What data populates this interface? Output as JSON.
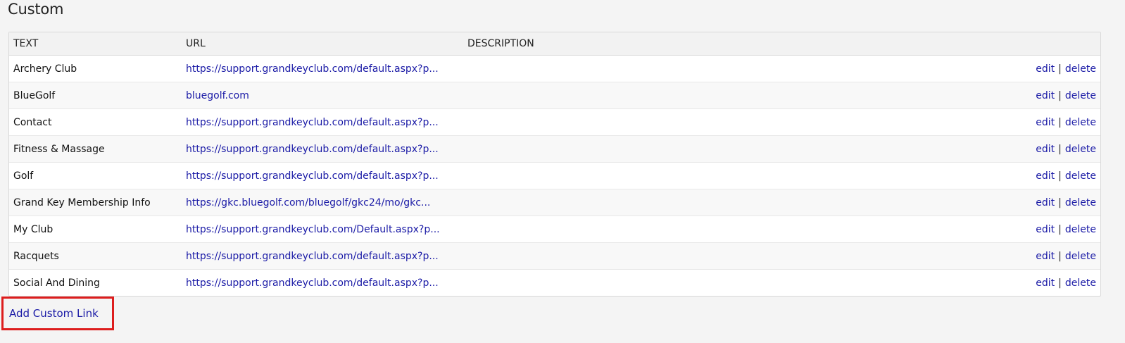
{
  "page": {
    "title": "Custom"
  },
  "table": {
    "headers": {
      "text": "TEXT",
      "url": "URL",
      "description": "DESCRIPTION"
    },
    "rows": [
      {
        "text": "Archery Club",
        "url": "https://support.grandkeyclub.com/default.aspx?p...",
        "description": "",
        "edit": "edit",
        "sep": "|",
        "delete": "delete"
      },
      {
        "text": "BlueGolf",
        "url": "bluegolf.com",
        "description": "",
        "edit": "edit",
        "sep": "|",
        "delete": "delete"
      },
      {
        "text": "Contact",
        "url": "https://support.grandkeyclub.com/default.aspx?p...",
        "description": "",
        "edit": "edit",
        "sep": "|",
        "delete": "delete"
      },
      {
        "text": "Fitness & Massage",
        "url": "https://support.grandkeyclub.com/default.aspx?p...",
        "description": "",
        "edit": "edit",
        "sep": "|",
        "delete": "delete"
      },
      {
        "text": "Golf",
        "url": "https://support.grandkeyclub.com/default.aspx?p...",
        "description": "",
        "edit": "edit",
        "sep": "|",
        "delete": "delete"
      },
      {
        "text": "Grand Key Membership Info",
        "url": "https://gkc.bluegolf.com/bluegolf/gkc24/mo/gkc...",
        "description": "",
        "edit": "edit",
        "sep": "|",
        "delete": "delete"
      },
      {
        "text": "My Club",
        "url": "https://support.grandkeyclub.com/Default.aspx?p...",
        "description": "",
        "edit": "edit",
        "sep": "|",
        "delete": "delete"
      },
      {
        "text": "Racquets",
        "url": "https://support.grandkeyclub.com/default.aspx?p...",
        "description": "",
        "edit": "edit",
        "sep": "|",
        "delete": "delete"
      },
      {
        "text": "Social And Dining",
        "url": "https://support.grandkeyclub.com/default.aspx?p...",
        "description": "",
        "edit": "edit",
        "sep": "|",
        "delete": "delete"
      }
    ]
  },
  "add_link": {
    "label": "Add Custom Link"
  },
  "colors": {
    "link": "#1a1aa6",
    "highlight_border": "#dd1d1d",
    "background": "#f4f4f4"
  }
}
